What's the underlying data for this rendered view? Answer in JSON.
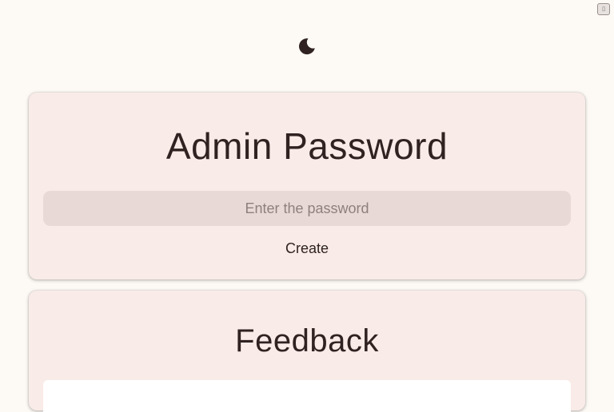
{
  "corner_button": {
    "glyph": "▯"
  },
  "theme_toggle": {
    "icon": "moon-icon"
  },
  "admin": {
    "title": "Admin Password",
    "password_placeholder": "Enter the password",
    "password_value": "",
    "create_label": "Create"
  },
  "feedback": {
    "title": "Feedback"
  },
  "colors": {
    "background": "#fdf9f5",
    "card": "#f9ebe7",
    "input": "#e9d9d6",
    "text": "#2f2220",
    "placeholder": "#8d807e"
  }
}
